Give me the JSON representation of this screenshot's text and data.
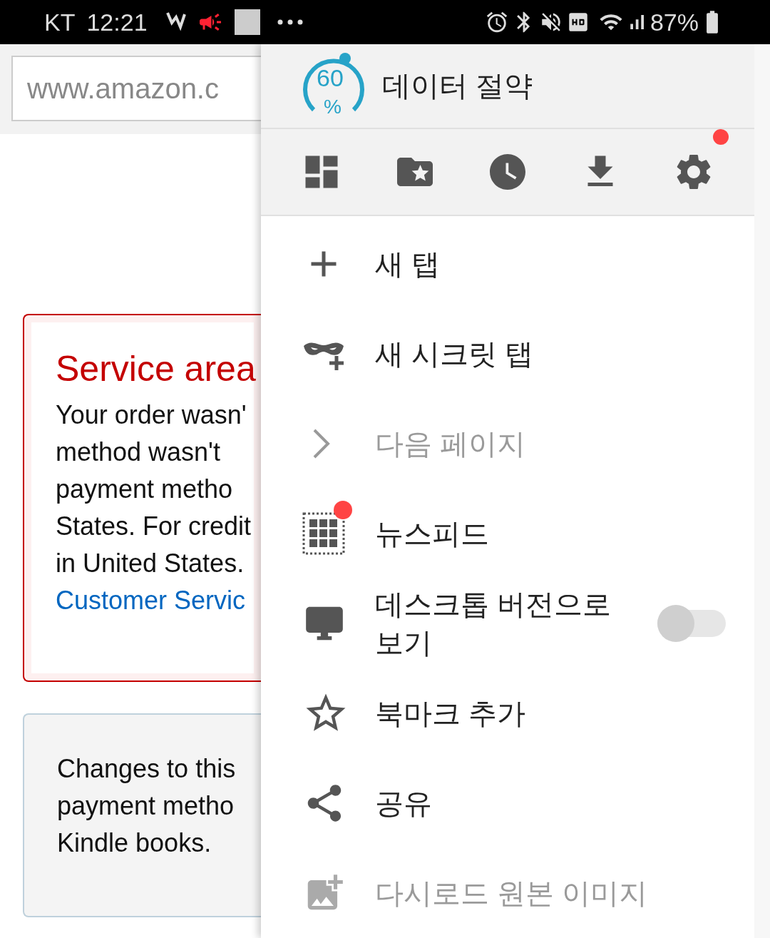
{
  "status_bar": {
    "carrier": "KT",
    "time": "12:21",
    "battery": "87%"
  },
  "address_bar": {
    "value": "www.amazon.c"
  },
  "alert_box": {
    "title": "Service area",
    "lines": [
      "Your order wasn'",
      "method wasn't",
      "payment metho",
      "States. For credit",
      "in United States."
    ],
    "link": "Customer Servic"
  },
  "info_box": {
    "lines": [
      "Changes to this",
      "payment metho",
      "Kindle books."
    ]
  },
  "menu": {
    "data_saver": {
      "value": "60",
      "unit": "%",
      "label": "데이터 절약"
    },
    "toolbar": [
      {
        "kind": "grid",
        "badge": false
      },
      {
        "kind": "folder-star",
        "badge": false
      },
      {
        "kind": "clock",
        "badge": false
      },
      {
        "kind": "download",
        "badge": false
      },
      {
        "kind": "settings",
        "badge": true
      }
    ],
    "items": [
      {
        "kind": "plus",
        "label": "새 탭",
        "disabled": false,
        "badge": false
      },
      {
        "kind": "incognito",
        "label": "새 시크릿 탭",
        "disabled": false,
        "badge": false
      },
      {
        "kind": "forward",
        "label": "다음 페이지",
        "disabled": true,
        "badge": false
      },
      {
        "kind": "newsfeed",
        "label": "뉴스피드",
        "disabled": false,
        "badge": true
      },
      {
        "kind": "desktop",
        "label": "데스크톱 버전으로 보기",
        "disabled": false,
        "badge": false,
        "on": false
      },
      {
        "kind": "bookmark",
        "label": "북마크 추가",
        "disabled": false,
        "badge": false
      },
      {
        "kind": "share",
        "label": "공유",
        "disabled": false,
        "badge": false
      },
      {
        "kind": "image",
        "label": "다시로드 원본 이미지",
        "disabled": true,
        "badge": false
      }
    ]
  }
}
